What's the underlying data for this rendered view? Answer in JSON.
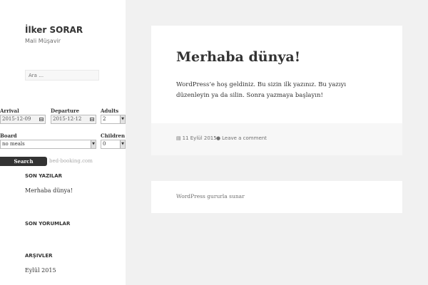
{
  "site": {
    "title": "İlker SORAR",
    "description": "Mali Müşavir",
    "search_placeholder": "Ara …"
  },
  "booking": {
    "arrival_label": "Arrival",
    "arrival_value": "2015-12-09",
    "departure_label": "Departure",
    "departure_value": "2015-12-12",
    "adults_label": "Adults",
    "adults_value": "2",
    "board_label": "Board",
    "board_value": "no meals",
    "children_label": "Children",
    "children_value": "0",
    "search_button": "Search",
    "powered_by": "bed-booking.com"
  },
  "widgets": {
    "recent_posts_title": "SON YAZILAR",
    "recent_posts": [
      "Merhaba dünya!"
    ],
    "recent_comments_title": "SON YORUMLAR",
    "archives_title": "ARŞIVLER",
    "archives": [
      "Eylül 2015"
    ]
  },
  "post": {
    "title": "Merhaba dünya!",
    "body": "WordPress’e hoş geldiniz. Bu sizin ilk yazınız. Bu yazıyı düzenleyin ya da silin. Sonra yazmaya başlayın!",
    "date": "11 Eylül 2015",
    "comment_link": "Leave a comment",
    "date_icon": "calendar-icon",
    "comment_icon": "comment-icon"
  },
  "footer": {
    "text": "WordPress gururla sunar"
  },
  "colors": {
    "background": "#f1f1f1",
    "sidebar": "#ffffff",
    "button": "#333333",
    "meta_footer": "#f7f7f7"
  }
}
